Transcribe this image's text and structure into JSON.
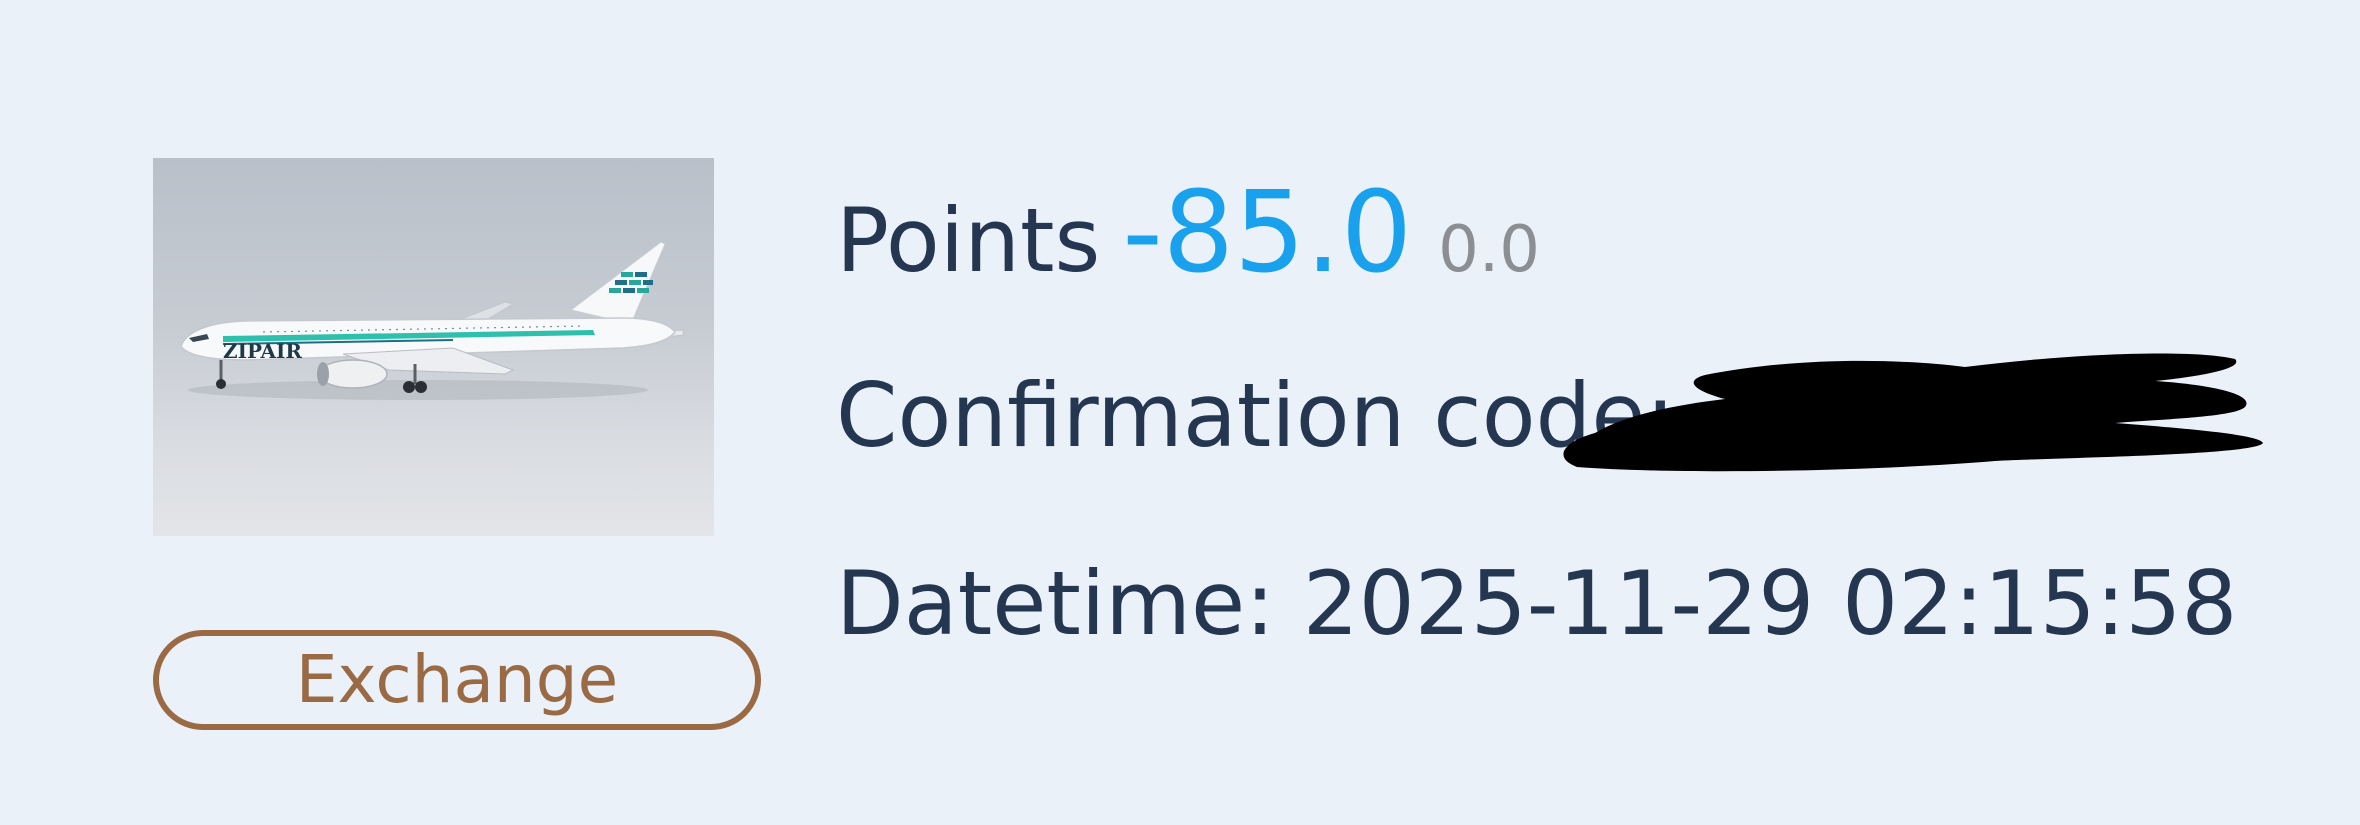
{
  "colors": {
    "background": "#eaf1f9",
    "text": "#243650",
    "points_accent": "#19a1ee",
    "muted": "#8b8e93",
    "exchange_brown": "#9a6a45",
    "redaction": "#000000"
  },
  "product": {
    "image_icon": "airplane-image",
    "livery_text": "ZIPAIR"
  },
  "actions": {
    "exchange_label": "Exchange"
  },
  "points": {
    "label": "Points",
    "value": "-85.0",
    "secondary": "0.0"
  },
  "confirmation": {
    "label": "Confirmation code:",
    "value_redacted": true
  },
  "datetime": {
    "label": "Datetime:",
    "value": "2025-11-29 02:15:58"
  }
}
